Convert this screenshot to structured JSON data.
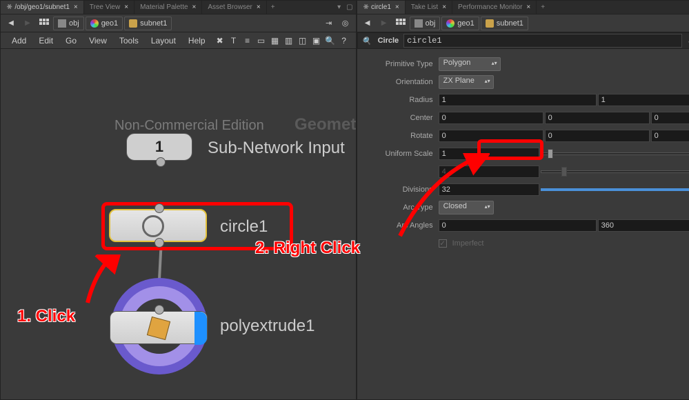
{
  "left": {
    "tabs": [
      {
        "label": "/obj/geo1/subnet1",
        "active": true,
        "pinned": true
      },
      {
        "label": "Tree View",
        "active": false
      },
      {
        "label": "Material Palette",
        "active": false
      },
      {
        "label": "Asset Browser",
        "active": false
      }
    ],
    "breadcrumb": {
      "obj": "obj",
      "geo": "geo1",
      "subnet": "subnet1"
    },
    "menu": {
      "add": "Add",
      "edit": "Edit",
      "go": "Go",
      "view": "View",
      "tools": "Tools",
      "layout": "Layout",
      "help": "Help"
    },
    "watermark1": "Non-Commercial Edition",
    "watermark2": "Geometry",
    "nodes": {
      "subnet_input": {
        "label": "Sub-Network Input",
        "number": "1"
      },
      "circle": {
        "label": "circle1"
      },
      "polyextrude": {
        "label": "polyextrude1"
      }
    },
    "annotations": {
      "step1": "1. Click",
      "step2": "2. Right Click"
    }
  },
  "right": {
    "tabs": [
      {
        "label": "circle1",
        "active": true,
        "pinned": true
      },
      {
        "label": "Take List",
        "active": false
      },
      {
        "label": "Performance Monitor",
        "active": false
      }
    ],
    "breadcrumb": {
      "obj": "obj",
      "geo": "geo1",
      "subnet": "subnet1"
    },
    "header": {
      "search_placeholder": "",
      "optype": "Circle",
      "name": "circle1"
    },
    "params": {
      "primtype": {
        "label": "Primitive Type",
        "value": "Polygon"
      },
      "orient": {
        "label": "Orientation",
        "value": "ZX Plane"
      },
      "radius": {
        "label": "Radius",
        "values": [
          "1",
          "1"
        ]
      },
      "center": {
        "label": "Center",
        "values": [
          "0",
          "0",
          "0"
        ]
      },
      "rotate": {
        "label": "Rotate",
        "values": [
          "0",
          "0",
          "0"
        ]
      },
      "scale": {
        "label": "Uniform Scale",
        "value": "1"
      },
      "order": {
        "label": "",
        "value": "4"
      },
      "divisions": {
        "label": "Divisions",
        "value": "32"
      },
      "arctype": {
        "label": "Arc Type",
        "value": "Closed"
      },
      "arcangles": {
        "label": "Arc Angles",
        "values": [
          "0",
          "360"
        ]
      },
      "imperfect": {
        "label": "Imperfect",
        "checked": true
      }
    }
  }
}
